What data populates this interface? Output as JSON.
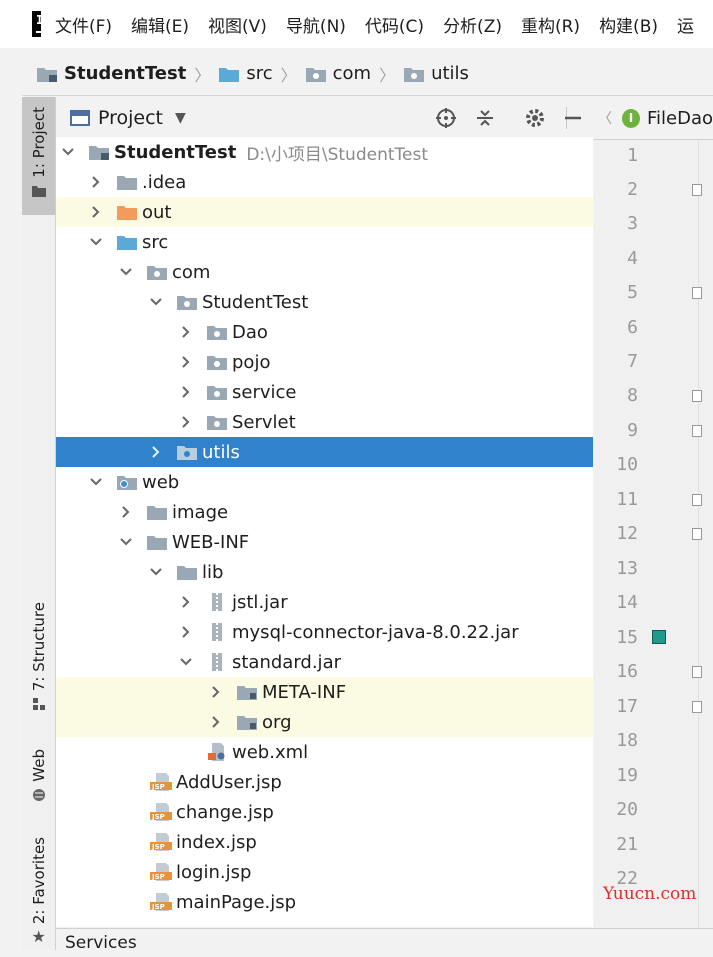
{
  "menubar": {
    "items": [
      "文件(F)",
      "编辑(E)",
      "视图(V)",
      "导航(N)",
      "代码(C)",
      "分析(Z)",
      "重构(R)",
      "构建(B)",
      "运"
    ]
  },
  "breadcrumb": {
    "items": [
      "StudentTest",
      "src",
      "com",
      "utils"
    ]
  },
  "left_strip": {
    "project_tab": "1: Project",
    "structure_tab": "7: Structure",
    "web_tab": "Web",
    "favorites_tab": "2: Favorites"
  },
  "panel": {
    "title": "Project"
  },
  "tree": {
    "root_name": "StudentTest",
    "root_path": "D:\\小项目\\StudentTest",
    "nodes": [
      ".idea",
      "out",
      "src",
      "com",
      "StudentTest",
      "Dao",
      "pojo",
      "service",
      "Servlet",
      "utils",
      "web",
      "image",
      "WEB-INF",
      "lib",
      "jstl.jar",
      "mysql-connector-java-8.0.22.jar",
      "standard.jar",
      "META-INF",
      "org",
      "web.xml",
      "AddUser.jsp",
      "change.jsp",
      "index.jsp",
      "login.jsp",
      "mainPage.jsp"
    ]
  },
  "editor": {
    "tab_label": "FileDao",
    "tab_icon_letter": "I",
    "line_numbers": [
      "1",
      "2",
      "3",
      "4",
      "5",
      "6",
      "7",
      "8",
      "9",
      "10",
      "11",
      "12",
      "13",
      "14",
      "15",
      "16",
      "17",
      "18",
      "19",
      "20",
      "21",
      "22"
    ]
  },
  "services_bar": {
    "label": "Services"
  },
  "watermark": "Yuucn.com",
  "colors": {
    "selection": "#3082cc",
    "highlight": "#fbfae3",
    "folder_blue": "#8fb6d9",
    "source_folder": "#5aa9d6",
    "excluded_folder": "#f39b5a"
  }
}
